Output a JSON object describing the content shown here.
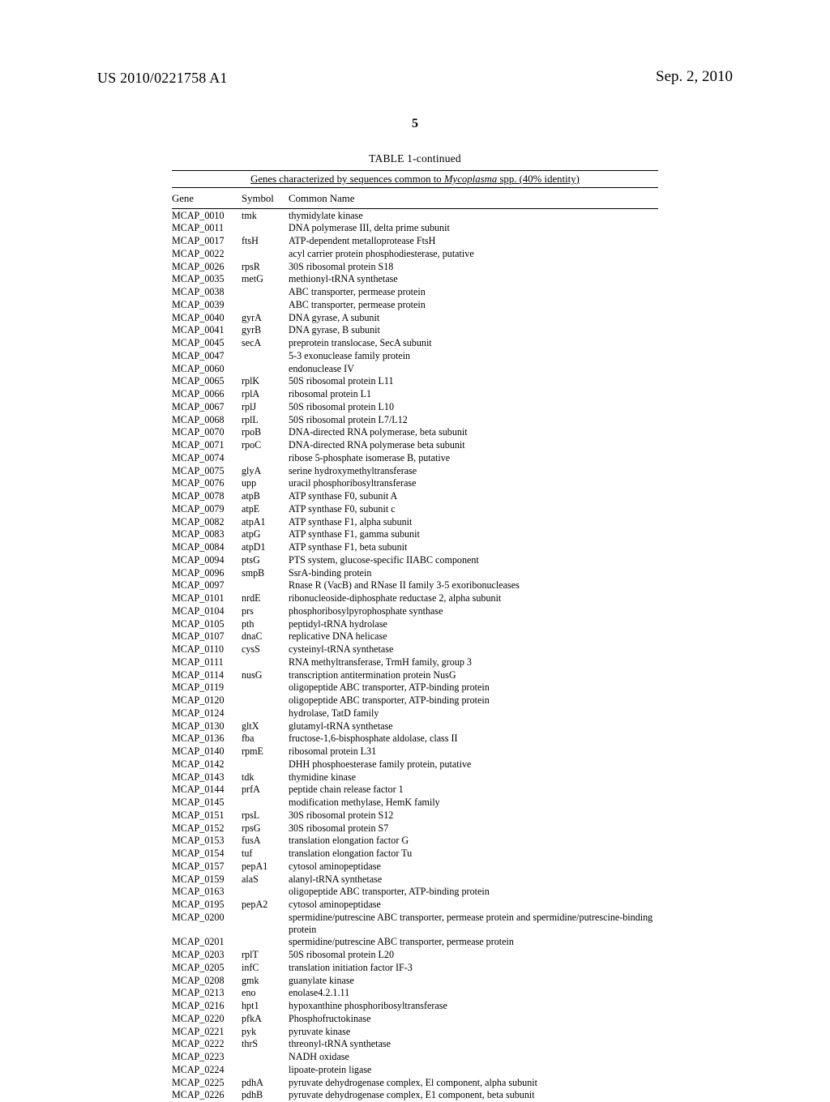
{
  "header": {
    "pubnum": "US 2010/0221758 A1",
    "pubdate": "Sep. 2, 2010",
    "pagenum": "5"
  },
  "table": {
    "title": "TABLE 1-continued",
    "subtitle_pre": "Genes characterized by sequences common to ",
    "subtitle_ital": "Mycoplasma",
    "subtitle_post": " spp. (40% identity)",
    "columns": [
      "Gene",
      "Symbol",
      "Common Name"
    ],
    "rows": [
      {
        "gene": "MCAP_0010",
        "symbol": "tmk",
        "name": "thymidylate kinase"
      },
      {
        "gene": "MCAP_0011",
        "symbol": "",
        "name": "DNA polymerase III, delta prime subunit"
      },
      {
        "gene": "MCAP_0017",
        "symbol": "ftsH",
        "name": "ATP-dependent metalloprotease FtsH"
      },
      {
        "gene": "MCAP_0022",
        "symbol": "",
        "name": "acyl carrier protein phosphodiesterase, putative"
      },
      {
        "gene": "MCAP_0026",
        "symbol": "rpsR",
        "name": "30S ribosomal protein S18"
      },
      {
        "gene": "MCAP_0035",
        "symbol": "metG",
        "name": "methionyl-tRNA synthetase"
      },
      {
        "gene": "MCAP_0038",
        "symbol": "",
        "name": "ABC transporter, permease protein"
      },
      {
        "gene": "MCAP_0039",
        "symbol": "",
        "name": "ABC transporter, permease protein"
      },
      {
        "gene": "MCAP_0040",
        "symbol": "gyrA",
        "name": "DNA gyrase, A subunit"
      },
      {
        "gene": "MCAP_0041",
        "symbol": "gyrB",
        "name": "DNA gyrase, B subunit"
      },
      {
        "gene": "MCAP_0045",
        "symbol": "secA",
        "name": "preprotein translocase, SecA subunit"
      },
      {
        "gene": "MCAP_0047",
        "symbol": "",
        "name": "5-3 exonuclease family protein"
      },
      {
        "gene": "MCAP_0060",
        "symbol": "",
        "name": "endonuclease IV"
      },
      {
        "gene": "MCAP_0065",
        "symbol": "rplK",
        "name": "50S ribosomal protein L11"
      },
      {
        "gene": "MCAP_0066",
        "symbol": "rplA",
        "name": "ribosomal protein L1"
      },
      {
        "gene": "MCAP_0067",
        "symbol": "rplJ",
        "name": "50S ribosomal protein L10"
      },
      {
        "gene": "MCAP_0068",
        "symbol": "rplL",
        "name": "50S ribosomal protein L7/L12"
      },
      {
        "gene": "MCAP_0070",
        "symbol": "rpoB",
        "name": "DNA-directed RNA polymerase, beta subunit"
      },
      {
        "gene": "MCAP_0071",
        "symbol": "rpoC",
        "name": "DNA-directed RNA polymerase beta subunit"
      },
      {
        "gene": "MCAP_0074",
        "symbol": "",
        "name": "ribose 5-phosphate isomerase B, putative"
      },
      {
        "gene": "MCAP_0075",
        "symbol": "glyA",
        "name": "serine hydroxymethyltransferase"
      },
      {
        "gene": "MCAP_0076",
        "symbol": "upp",
        "name": "uracil phosphoribosyltransferase"
      },
      {
        "gene": "MCAP_0078",
        "symbol": "atpB",
        "name": "ATP synthase F0, subunit A"
      },
      {
        "gene": "MCAP_0079",
        "symbol": "atpE",
        "name": "ATP synthase F0, subunit c"
      },
      {
        "gene": "MCAP_0082",
        "symbol": "atpA1",
        "name": "ATP synthase F1, alpha subunit"
      },
      {
        "gene": "MCAP_0083",
        "symbol": "atpG",
        "name": "ATP synthase F1, gamma subunit"
      },
      {
        "gene": "MCAP_0084",
        "symbol": "atpD1",
        "name": "ATP synthase F1, beta subunit"
      },
      {
        "gene": "MCAP_0094",
        "symbol": "ptsG",
        "name": "PTS system, glucose-specific IIABC component"
      },
      {
        "gene": "MCAP_0096",
        "symbol": "smpB",
        "name": "SsrA-binding protein"
      },
      {
        "gene": "MCAP_0097",
        "symbol": "",
        "name": "Rnase R (VacB) and RNase II family 3-5 exoribonucleases"
      },
      {
        "gene": "MCAP_0101",
        "symbol": "nrdE",
        "name": "ribonucleoside-diphosphate reductase 2, alpha subunit"
      },
      {
        "gene": "MCAP_0104",
        "symbol": "prs",
        "name": "phosphoribosylpyrophosphate synthase"
      },
      {
        "gene": "MCAP_0105",
        "symbol": "pth",
        "name": "peptidyl-tRNA hydrolase"
      },
      {
        "gene": "MCAP_0107",
        "symbol": "dnaC",
        "name": "replicative DNA helicase"
      },
      {
        "gene": "MCAP_0110",
        "symbol": "cysS",
        "name": "cysteinyl-tRNA synthetase"
      },
      {
        "gene": "MCAP_0111",
        "symbol": "",
        "name": "RNA methyltransferase, TrmH family, group 3"
      },
      {
        "gene": "MCAP_0114",
        "symbol": "nusG",
        "name": "transcription antitermination protein NusG"
      },
      {
        "gene": "MCAP_0119",
        "symbol": "",
        "name": "oligopeptide ABC transporter, ATP-binding protein"
      },
      {
        "gene": "MCAP_0120",
        "symbol": "",
        "name": "oligopeptide ABC transporter, ATP-binding protein"
      },
      {
        "gene": "MCAP_0124",
        "symbol": "",
        "name": "hydrolase, TatD family"
      },
      {
        "gene": "MCAP_0130",
        "symbol": "gltX",
        "name": "glutamyl-tRNA synthetase"
      },
      {
        "gene": "MCAP_0136",
        "symbol": "fba",
        "name": "fructose-1,6-bisphosphate aldolase, class II"
      },
      {
        "gene": "MCAP_0140",
        "symbol": "rpmE",
        "name": "ribosomal protein L31"
      },
      {
        "gene": "MCAP_0142",
        "symbol": "",
        "name": "DHH phosphoesterase family protein, putative"
      },
      {
        "gene": "MCAP_0143",
        "symbol": "tdk",
        "name": "thymidine kinase"
      },
      {
        "gene": "MCAP_0144",
        "symbol": "prfA",
        "name": "peptide chain release factor 1"
      },
      {
        "gene": "MCAP_0145",
        "symbol": "",
        "name": "modification methylase, HemK family"
      },
      {
        "gene": "MCAP_0151",
        "symbol": "rpsL",
        "name": "30S ribosomal protein S12"
      },
      {
        "gene": "MCAP_0152",
        "symbol": "rpsG",
        "name": "30S ribosomal protein S7"
      },
      {
        "gene": "MCAP_0153",
        "symbol": "fusA",
        "name": "translation elongation factor G"
      },
      {
        "gene": "MCAP_0154",
        "symbol": "tuf",
        "name": "translation elongation factor Tu"
      },
      {
        "gene": "MCAP_0157",
        "symbol": "pepA1",
        "name": "cytosol aminopeptidase"
      },
      {
        "gene": "MCAP_0159",
        "symbol": "alaS",
        "name": "alanyl-tRNA synthetase"
      },
      {
        "gene": "MCAP_0163",
        "symbol": "",
        "name": "oligopeptide ABC transporter, ATP-binding protein"
      },
      {
        "gene": "MCAP_0195",
        "symbol": "pepA2",
        "name": "cytosol aminopeptidase"
      },
      {
        "gene": "MCAP_0200",
        "symbol": "",
        "name": "spermidine/putrescine ABC transporter, permease protein and spermidine/putrescine-binding protein"
      },
      {
        "gene": "MCAP_0201",
        "symbol": "",
        "name": "spermidine/putrescine ABC transporter, permease protein"
      },
      {
        "gene": "MCAP_0203",
        "symbol": "rplT",
        "name": "50S ribosomal protein L20"
      },
      {
        "gene": "MCAP_0205",
        "symbol": "infC",
        "name": "translation initiation factor IF-3"
      },
      {
        "gene": "MCAP_0208",
        "symbol": "gmk",
        "name": "guanylate kinase"
      },
      {
        "gene": "MCAP_0213",
        "symbol": "eno",
        "name": "enolase4.2.1.11"
      },
      {
        "gene": "MCAP_0216",
        "symbol": "hpt1",
        "name": "hypoxanthine phosphoribosyltransferase"
      },
      {
        "gene": "MCAP_0220",
        "symbol": "pfkA",
        "name": "Phosphofructokinase"
      },
      {
        "gene": "MCAP_0221",
        "symbol": "pyk",
        "name": "pyruvate kinase"
      },
      {
        "gene": "MCAP_0222",
        "symbol": "thrS",
        "name": "threonyl-tRNA synthetase"
      },
      {
        "gene": "MCAP_0223",
        "symbol": "",
        "name": "NADH oxidase"
      },
      {
        "gene": "MCAP_0224",
        "symbol": "",
        "name": "lipoate-protein ligase"
      },
      {
        "gene": "MCAP_0225",
        "symbol": "pdhA",
        "name": "pyruvate dehydrogenase complex, El component, alpha subunit"
      },
      {
        "gene": "MCAP_0226",
        "symbol": "pdhB",
        "name": "pyruvate dehydrogenase complex, E1 component, beta subunit"
      }
    ]
  }
}
